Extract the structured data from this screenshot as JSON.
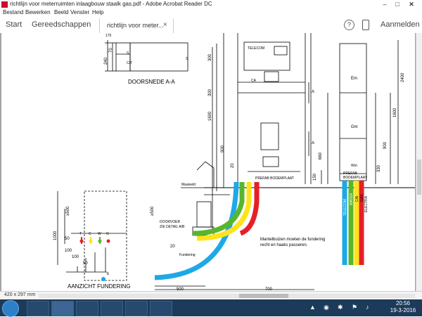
{
  "window": {
    "title": "richtlijn voor meterruimten inlaagbouw staalk gas.pdf - Adobe Acrobat Reader DC",
    "minimize_icon": "minimize-icon",
    "maximize_icon": "maximize-icon",
    "close_icon": "close-icon"
  },
  "menu": [
    "Bestand",
    "Bewerken",
    "Beeld",
    "Venster",
    "Help"
  ],
  "toolbar": {
    "start": "Start",
    "tools": "Gereedschappen",
    "doc_tab": "richtlijn voor meter...",
    "doc_tab_close": "×",
    "help_icon": "?",
    "signin": "Aanmelden"
  },
  "drawing": {
    "doorsnede_title": "DOORSNEDE A-A",
    "aanzicht_title": "AANZICHT FUNDERING",
    "telecom": "TELECOM",
    "ca": "CA",
    "section_a": "A",
    "prefab_bodemplaat": "PREFAB BODEMPLAAT",
    "prefab_bodemplaat_r1": "PREFAB",
    "prefab_bodemplaat_r2": "BODEMPLAAT",
    "maaiveld": "Maaiveld",
    "doorvoer_1": "DOORVOER",
    "doorvoer_2": "ZIE DETAIL A/B",
    "fundering": "Fundering",
    "mantel_1": "Mantelbuizen moeten de fundering",
    "mantel_2": "recht en haaks passeren.",
    "em": "Em",
    "gm": "Gm",
    "wm": "Wm",
    "pipe_labels": [
      "TELECOM",
      "WATER",
      "CAI",
      "GAS",
      "ELECTRA"
    ],
    "s": "S",
    "ct": "C/T",
    "dims": {
      "d300": "300",
      "d1600": "1600",
      "d900": "900",
      "d20": "20",
      "d660": "660",
      "d150": "150",
      "d2400": "2400",
      "d1600r": "1600",
      "d900r": "900",
      "d330": "330",
      "d240": "240",
      "d70": "70",
      "d170": "170",
      "d500v": "≥500",
      "d1000": "1000",
      "d50": "50",
      "d100a": "100",
      "d100b": "100",
      "d50b": "50",
      "d20b": "20",
      "d500": "500",
      "d700": "700"
    },
    "markers": [
      "T",
      "C",
      "W",
      "G",
      "E"
    ]
  },
  "status": {
    "page_size": "420 x 297 mm"
  },
  "taskbar": {
    "apps": [
      "ie-icon",
      "acrobat-icon",
      "explorer-icon",
      "chrome-icon",
      "paint-icon",
      "photoshop-icon"
    ],
    "clock_time": "20:56",
    "clock_date": "19-3-2016"
  }
}
